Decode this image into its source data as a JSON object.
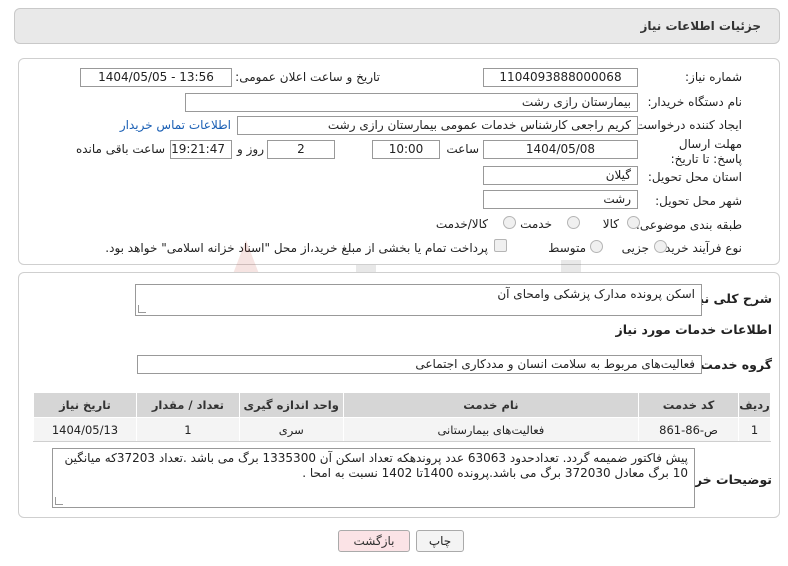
{
  "header": {
    "title": "جزئیات اطلاعات نیاز"
  },
  "form": {
    "need_number_label": "شماره نیاز:",
    "need_number": "1104093888000068",
    "announce_label": "تاریخ و ساعت اعلان عمومی:",
    "announce_value": "1404/05/05 - 13:56",
    "buyer_org_label": "نام دستگاه خریدار:",
    "buyer_org": "بیمارستان رازی رشت",
    "creator_label": "ایجاد کننده درخواست:",
    "creator": "کریم راجعی کارشناس خدمات عمومی بیمارستان رازی رشت",
    "buyer_contact_link": "اطلاعات تماس خریدار",
    "deadline_label": "مهلت ارسال پاسخ: تا تاریخ:",
    "deadline_date": "1404/05/08",
    "time_label": "ساعت",
    "deadline_time": "10:00",
    "days_count": "2",
    "days_label": "روز و",
    "remaining_time": "19:21:47",
    "remaining_label": "ساعت باقی مانده",
    "province_label": "استان محل تحویل:",
    "province": "گیلان",
    "city_label": "شهر محل تحویل:",
    "city": "رشت",
    "category_label": "طبقه بندی موضوعی:",
    "category_options": [
      "کالا",
      "خدمت",
      "کالا/خدمت"
    ],
    "process_label": "نوع فرآیند خرید :",
    "process_options": [
      "جزیی",
      "متوسط"
    ],
    "payment_note": "پرداخت تمام یا بخشی از مبلغ خرید،از محل \"اسناد خزانه اسلامی\" خواهد بود."
  },
  "details": {
    "summary_label": "شرح کلی نیاز:",
    "summary": "اسکن پرونده مدارک پزشکی وامحای آن",
    "services_heading": "اطلاعات خدمات مورد نیاز",
    "service_group_label": "گروه خدمت:",
    "service_group": "فعالیت‌های مربوط به سلامت انسان و مددکاری اجتماعی",
    "table": {
      "headers": [
        "ردیف",
        "کد خدمت",
        "نام خدمت",
        "واحد اندازه گیری",
        "تعداد / مقدار",
        "تاریخ نیاز"
      ],
      "rows": [
        [
          "1",
          "ص-86-861",
          "فعالیت‌های بیمارستانی",
          "سری",
          "1",
          "1404/05/13"
        ]
      ]
    },
    "buyer_notes_label": "توضیحات خریدار:",
    "buyer_notes": "پیش فاکتور ضمیمه گردد. تعدادحدود 63063 عدد پروندهکه تعداد اسکن آن 1335300 برگ می باشد .تعداد 37203که میانگین 10 برگ معادل 372030 برگ می باشد.پرونده 1400تا 1402 نسبت به امحا ."
  },
  "buttons": {
    "print": "چاپ",
    "back": "بازگشت"
  },
  "colors": {
    "link": "#1a5fb4",
    "back_button": "#fbe3e6",
    "watermark": "#c0392b"
  }
}
